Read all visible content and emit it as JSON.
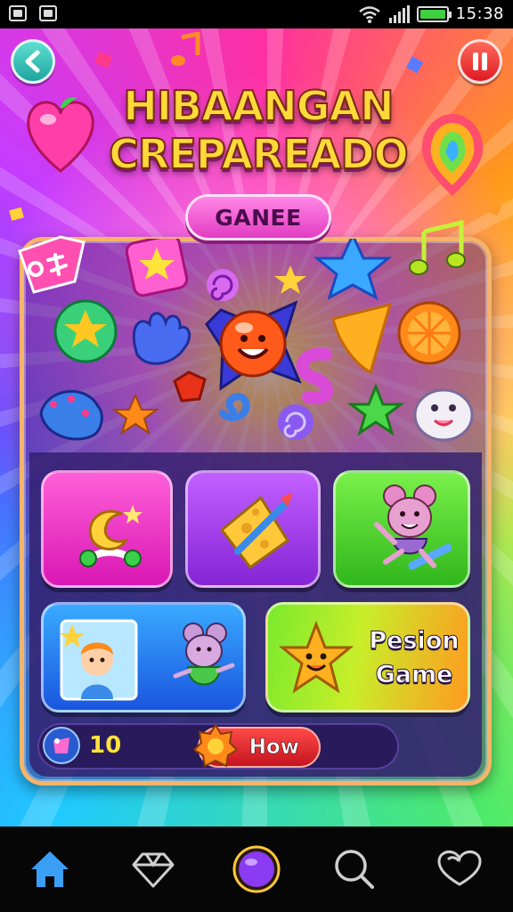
{
  "status_bar": {
    "time": "15:38",
    "battery_level": 1.0,
    "icons": [
      "gallery-icon",
      "image-icon",
      "wifi-icon",
      "signal-icon",
      "battery-icon"
    ]
  },
  "header": {
    "title_line_1": "HIBAANGAN",
    "title_line_2": "CREPAREADO",
    "subtitle": "GANEE"
  },
  "panel": {
    "tag_icon": "tag-icon",
    "cards": [
      {
        "icon": "moon-toy-icon",
        "color": "#f02ec8"
      },
      {
        "icon": "cheese-icon",
        "color": "#a63ff0"
      },
      {
        "icon": "mouse-icon",
        "color": "#4fd22a"
      },
      {
        "icon": "characters-icon",
        "color": "#2a7ef0"
      },
      {
        "icon": "star-face-icon",
        "label_line_1": "Pesion",
        "label_line_2": "Game",
        "color": "#9ee82a"
      }
    ],
    "score": "10",
    "how_button": "How"
  },
  "nav": {
    "items": [
      "home-icon",
      "diamond-icon",
      "orb-icon",
      "search-icon",
      "heart-icon"
    ],
    "active": "home-icon"
  },
  "colors": {
    "title_fill": "#ffd93a",
    "pill": "#e23cc2",
    "score": "#ffe23a",
    "how_button": "#e01a24",
    "nav_active": "#3a9ff5"
  }
}
